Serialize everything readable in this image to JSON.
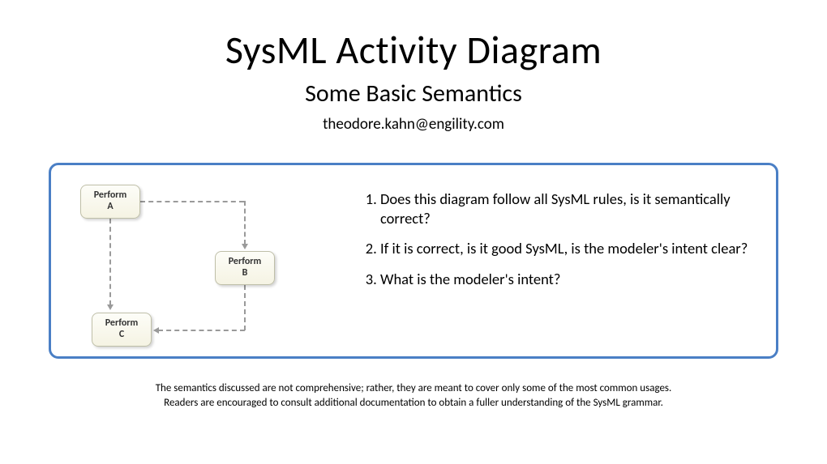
{
  "title": "SysML Activity Diagram",
  "subtitle": "Some Basic Semantics",
  "author": "theodore.kahn@engility.com",
  "diagram": {
    "nodes": {
      "a": "Perform\nA",
      "b": "Perform\nB",
      "c": "Perform\nC"
    }
  },
  "questions": {
    "q1": "Does this diagram follow all SysML rules, is it semantically correct?",
    "q2": "If it is correct, is it good SysML, is the modeler's intent clear?",
    "q3": "What is the modeler's intent?"
  },
  "footnote_line1": "The semantics discussed are not comprehensive; rather, they are meant to cover only some of the most common usages.",
  "footnote_line2": "Readers are encouraged to consult additional documentation to obtain a fuller understanding of the SysML grammar."
}
